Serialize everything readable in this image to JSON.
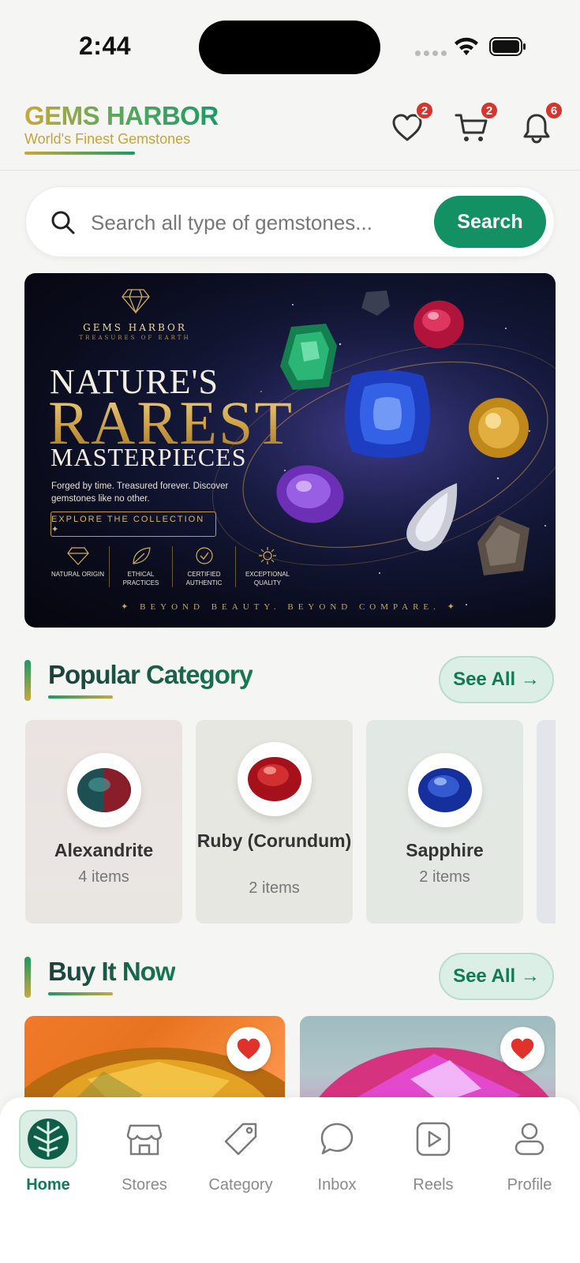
{
  "status_bar": {
    "time": "2:44"
  },
  "header": {
    "brand": "GEMS HARBOR",
    "tagline": "World's Finest Gemstones",
    "wishlist_count": "2",
    "cart_count": "2",
    "notifications_count": "6"
  },
  "search": {
    "placeholder": "Search all type of gemstones...",
    "button_label": "Search"
  },
  "banner": {
    "brand": "GEMS HARBOR",
    "brand_sub": "TREASURES OF EARTH",
    "line1": "NATURE'S",
    "line2": "RAREST",
    "line3": "MASTERPIECES",
    "description": "Forged by time. Treasured forever. Discover gemstones like no other.",
    "cta": "EXPLORE THE COLLECTION ✦",
    "features": [
      "NATURAL ORIGIN",
      "ETHICAL PRACTICES",
      "CERTIFIED AUTHENTIC",
      "EXCEPTIONAL QUALITY"
    ],
    "footer": "✦ BEYOND BEAUTY. BEYOND COMPARE. ✦"
  },
  "popular_category": {
    "title": "Popular Category",
    "see_all": "See All →",
    "items": [
      {
        "name": "Alexandrite",
        "count": "4 items",
        "color": "#2b6b6a"
      },
      {
        "name": "Ruby (Corundum)",
        "count": "2 items",
        "color": "#b3141c"
      },
      {
        "name": "Sapphire",
        "count": "2 items",
        "color": "#1b3fb0"
      }
    ]
  },
  "buy_it_now": {
    "title": "Buy It Now",
    "see_all": "See All →"
  },
  "bottom_nav": {
    "items": [
      {
        "label": "Home",
        "icon": "home-icon",
        "active": true
      },
      {
        "label": "Stores",
        "icon": "store-icon"
      },
      {
        "label": "Category",
        "icon": "tag-icon"
      },
      {
        "label": "Inbox",
        "icon": "chat-icon"
      },
      {
        "label": "Reels",
        "icon": "play-icon"
      },
      {
        "label": "Profile",
        "icon": "user-icon"
      }
    ]
  },
  "colors": {
    "primary": "#139164",
    "accent_gold": "#c8a83a",
    "badge": "#d6342c"
  }
}
